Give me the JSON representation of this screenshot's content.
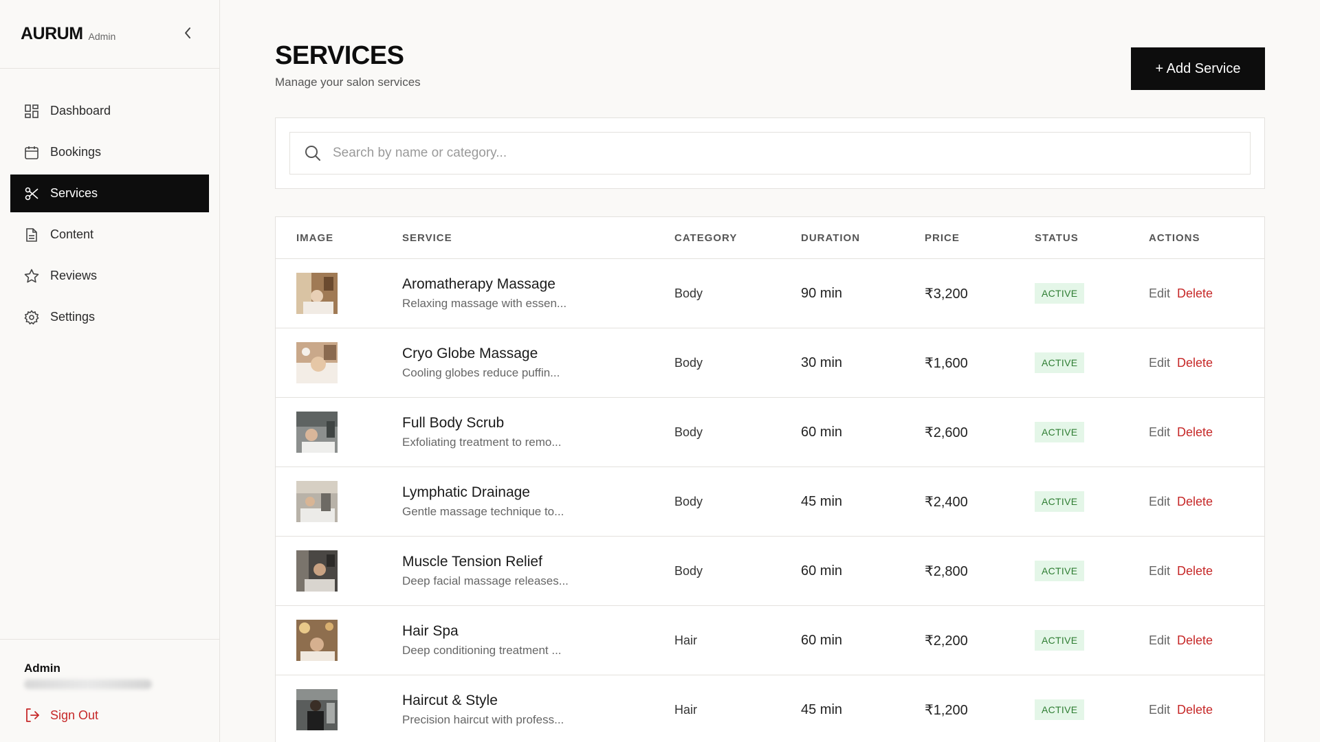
{
  "sidebar": {
    "brand": "AURUM",
    "brand_sub": "Admin",
    "items": [
      {
        "label": "Dashboard",
        "icon": "dashboard-icon"
      },
      {
        "label": "Bookings",
        "icon": "calendar-icon"
      },
      {
        "label": "Services",
        "icon": "scissors-icon",
        "active": true
      },
      {
        "label": "Content",
        "icon": "document-icon"
      },
      {
        "label": "Reviews",
        "icon": "star-icon"
      },
      {
        "label": "Settings",
        "icon": "gear-icon"
      }
    ],
    "footer": {
      "user_name": "Admin",
      "sign_out": "Sign Out"
    }
  },
  "header": {
    "title": "SERVICES",
    "subtitle": "Manage your salon services",
    "add_button": "+ Add Service"
  },
  "search": {
    "placeholder": "Search by name or category..."
  },
  "table": {
    "columns": [
      "IMAGE",
      "SERVICE",
      "CATEGORY",
      "DURATION",
      "PRICE",
      "STATUS",
      "ACTIONS"
    ],
    "rows": [
      {
        "name": "Aromatherapy Massage",
        "desc": "Relaxing massage with essen...",
        "category": "Body",
        "duration": "90 min",
        "price": "₹3,200",
        "status": "ACTIVE"
      },
      {
        "name": "Cryo Globe Massage",
        "desc": "Cooling globes reduce puffin...",
        "category": "Body",
        "duration": "30 min",
        "price": "₹1,600",
        "status": "ACTIVE"
      },
      {
        "name": "Full Body Scrub",
        "desc": "Exfoliating treatment to remo...",
        "category": "Body",
        "duration": "60 min",
        "price": "₹2,600",
        "status": "ACTIVE"
      },
      {
        "name": "Lymphatic Drainage",
        "desc": "Gentle massage technique to...",
        "category": "Body",
        "duration": "45 min",
        "price": "₹2,400",
        "status": "ACTIVE"
      },
      {
        "name": "Muscle Tension Relief",
        "desc": "Deep facial massage releases...",
        "category": "Body",
        "duration": "60 min",
        "price": "₹2,800",
        "status": "ACTIVE"
      },
      {
        "name": "Hair Spa",
        "desc": "Deep conditioning treatment ...",
        "category": "Hair",
        "duration": "60 min",
        "price": "₹2,200",
        "status": "ACTIVE"
      },
      {
        "name": "Haircut & Style",
        "desc": "Precision haircut with profess...",
        "category": "Hair",
        "duration": "45 min",
        "price": "₹1,200",
        "status": "ACTIVE"
      }
    ],
    "edit_label": "Edit",
    "delete_label": "Delete"
  },
  "colors": {
    "accent": "#0d0d0d",
    "danger": "#c62828",
    "success_bg": "#e4f6e8",
    "success_text": "#2e7d32"
  }
}
